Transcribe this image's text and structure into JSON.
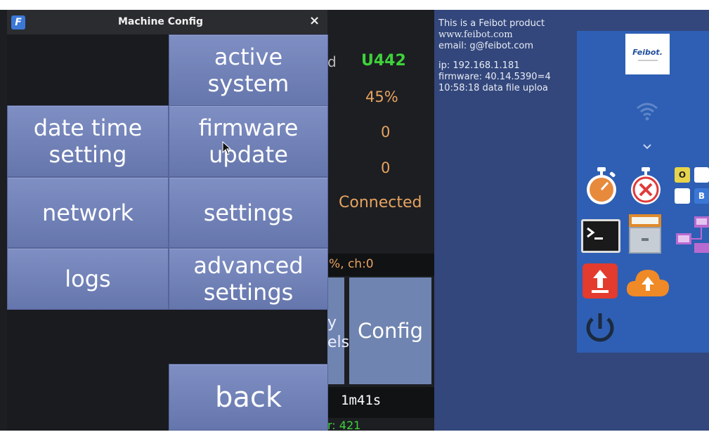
{
  "dialog": {
    "title": "Machine Config",
    "close_label": "×",
    "app_icon_letter": "F",
    "buttons": {
      "active_system_1": "active",
      "active_system_2": "system",
      "date_time_1": "date time",
      "date_time_2": "setting",
      "firmware_1": "firmware",
      "firmware_2": "update",
      "network": "network",
      "settings": "settings",
      "logs": "logs",
      "advanced_1": "advanced",
      "advanced_2": "settings",
      "back": "back"
    }
  },
  "background_app": {
    "label_fragment": "d",
    "machine_id": "U442",
    "percent": "45%",
    "value_a": "0",
    "value_b": "0",
    "connection": "Connected",
    "status_fragment": "%, ch:0",
    "button_fragment_1": "y",
    "button_fragment_2": "els",
    "config_label": "Config",
    "elapsed": "1m41s",
    "bottom_fragment": "r: 421"
  },
  "info": {
    "line1": "This is a Feibot product",
    "line2": "www.feibot.com",
    "line3": "email: g@feibot.com",
    "line4": "ip: 192.168.1.181",
    "line5": "firmware: 40.14.5390=4",
    "line6": "10:58:18 data file uploa"
  },
  "side_panel": {
    "logo_text": "Feibot.",
    "square_o": "O",
    "square_b": "B"
  },
  "colors": {
    "button": "#7384bb",
    "accent_green": "#3fd23a",
    "accent_orange": "#e7a35f",
    "panel_blue": "#2e5fb4"
  }
}
